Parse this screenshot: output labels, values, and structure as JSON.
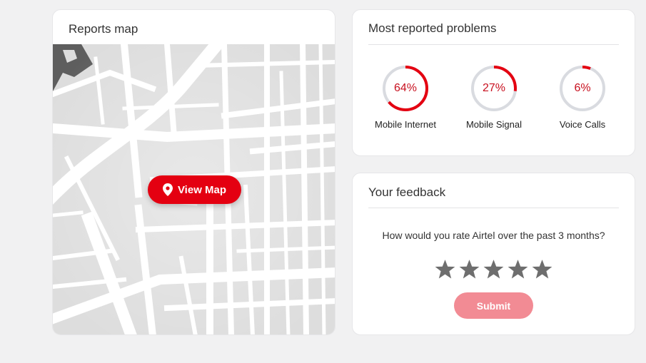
{
  "reports_map": {
    "title": "Reports map",
    "view_map_label": "View Map",
    "button_color": "#e40011"
  },
  "problems": {
    "title": "Most reported problems",
    "accent_color": "#e40011",
    "track_color": "#d9dbe0",
    "items": [
      {
        "label": "Mobile Internet",
        "value": 64,
        "display": "64%"
      },
      {
        "label": "Mobile Signal",
        "value": 27,
        "display": "27%"
      },
      {
        "label": "Voice Calls",
        "value": 6,
        "display": "6%"
      }
    ]
  },
  "feedback": {
    "title": "Your feedback",
    "question": "How would you rate Airtel over the past 3 months?",
    "rating": {
      "selected": 0,
      "max": 5
    },
    "star_color": "#6e6e6e",
    "submit_label": "Submit",
    "submit_color": "#f28b94"
  }
}
